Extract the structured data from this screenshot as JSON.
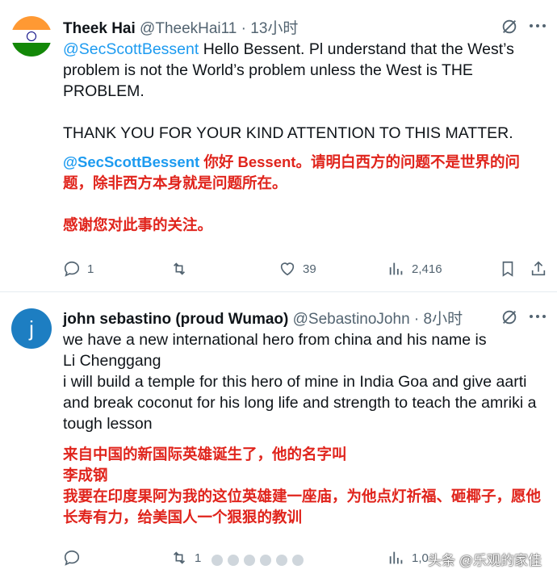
{
  "tweets": [
    {
      "author_name": "Theek Hai",
      "author_handle": "@TheekHai11",
      "time": "· 13小时",
      "avatar": "india-flag",
      "mention": "@SecScottBessent",
      "body_rest": "  Hello Bessent. Pl understand that the West’s problem is not the World’s problem unless  the West is THE PROBLEM.\n\nTHANK YOU FOR YOUR KIND ATTENTION TO THIS MATTER.",
      "translation_mention": "@SecScottBessent",
      "translation_rest": " 你好 Bessent。请明白西方的问题不是世界的问题，除非西方本身就是问题所在。\n\n感谢您对此事的关注。",
      "replies": "1",
      "retweets": "",
      "likes": "39",
      "views": "2,416"
    },
    {
      "author_name": "john sebastino (proud Wumao)",
      "author_handle": "@SebastinoJohn",
      "time": "· 8小时",
      "avatar_letter": "j",
      "body": "we have a new international hero from china and his name is\nLi Chenggang\ni will build a temple for this hero of mine in India Goa and give aarti and break coconut for his long life and strength to teach the amriki a tough lesson",
      "translation": "来自中国的新国际英雄诞生了，他的名字叫\n李成钢\n我要在印度果阿为我的这位英雄建一座庙，为他点灯祈福、砸椰子，愿他长寿有力，给美国人一个狠狠的教训",
      "replies": "",
      "retweets": "1",
      "likes": "",
      "views": "1,0"
    }
  ],
  "watermark": "头条 @乐观的家佳",
  "colors": {
    "mention": "#1d9bf0",
    "translation": "#e0241c",
    "secondary": "#536471"
  }
}
